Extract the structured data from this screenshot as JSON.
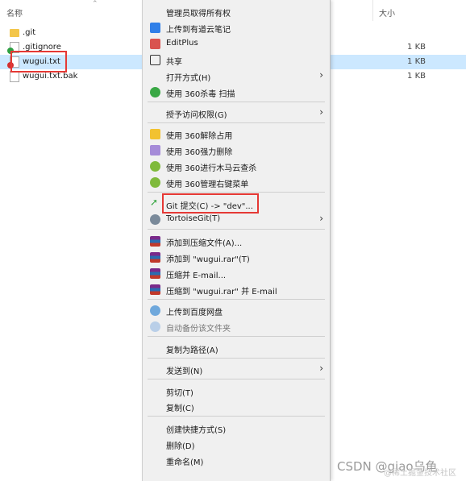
{
  "header": {
    "name_col": "名称",
    "size_col": "大小"
  },
  "files": [
    {
      "name": ".git",
      "size": "",
      "type": "folder"
    },
    {
      "name": ".gitignore",
      "size": "1 KB",
      "type": "doc",
      "badge": "green"
    },
    {
      "name": "wugui.txt",
      "size": "1 KB",
      "type": "doc",
      "badge": "red",
      "selected": true
    },
    {
      "name": "wugui.txt.bak",
      "size": "1 KB",
      "type": "doc"
    }
  ],
  "menu": {
    "items": [
      {
        "label": "管理员取得所有权",
        "icon": "none"
      },
      {
        "label": "上传到有道云笔记",
        "icon": "youdao-icon"
      },
      {
        "label": "EditPlus",
        "icon": "editplus-icon"
      },
      {
        "label": "共享",
        "icon": "share-icon"
      },
      {
        "label": "打开方式(H)",
        "icon": "none",
        "submenu": true
      },
      {
        "label": "使用 360杀毒 扫描",
        "icon": "shield-360-icon"
      },
      {
        "label": "授予访问权限(G)",
        "icon": "none",
        "submenu": true
      },
      {
        "label": "使用 360解除占用",
        "icon": "unlock-360-icon"
      },
      {
        "label": "使用 360强力删除",
        "icon": "delete-360-icon"
      },
      {
        "label": "使用 360进行木马云查杀",
        "icon": "trojan-360-icon"
      },
      {
        "label": "使用 360管理右键菜单",
        "icon": "menu-360-icon"
      },
      {
        "label": "Git 提交(C) -> \"dev\"...",
        "icon": "git-commit-icon"
      },
      {
        "label": "TortoiseGit(T)",
        "icon": "tortoisegit-icon",
        "submenu": true
      },
      {
        "label": "添加到压缩文件(A)...",
        "icon": "winrar-icon"
      },
      {
        "label": "添加到 \"wugui.rar\"(T)",
        "icon": "winrar-icon"
      },
      {
        "label": "压缩并 E-mail...",
        "icon": "winrar-icon"
      },
      {
        "label": "压缩到 \"wugui.rar\" 并 E-mail",
        "icon": "winrar-icon"
      },
      {
        "label": "上传到百度网盘",
        "icon": "baidu-cloud-icon"
      },
      {
        "label": "自动备份该文件夹",
        "icon": "baidu-backup-icon"
      },
      {
        "label": "复制为路径(A)",
        "icon": "none"
      },
      {
        "label": "发送到(N)",
        "icon": "none",
        "submenu": true
      },
      {
        "label": "剪切(T)",
        "icon": "none"
      },
      {
        "label": "复制(C)",
        "icon": "none"
      },
      {
        "label": "创建快捷方式(S)",
        "icon": "none"
      },
      {
        "label": "删除(D)",
        "icon": "none"
      },
      {
        "label": "重命名(M)",
        "icon": "none"
      }
    ]
  },
  "watermark": {
    "text": "CSDN @giao乌龟",
    "subtext": "@稀土掘金技术社区"
  },
  "colors": {
    "selection": "#cce8ff",
    "highlight": "#e53935",
    "menu_bg": "#f0f0f0"
  }
}
